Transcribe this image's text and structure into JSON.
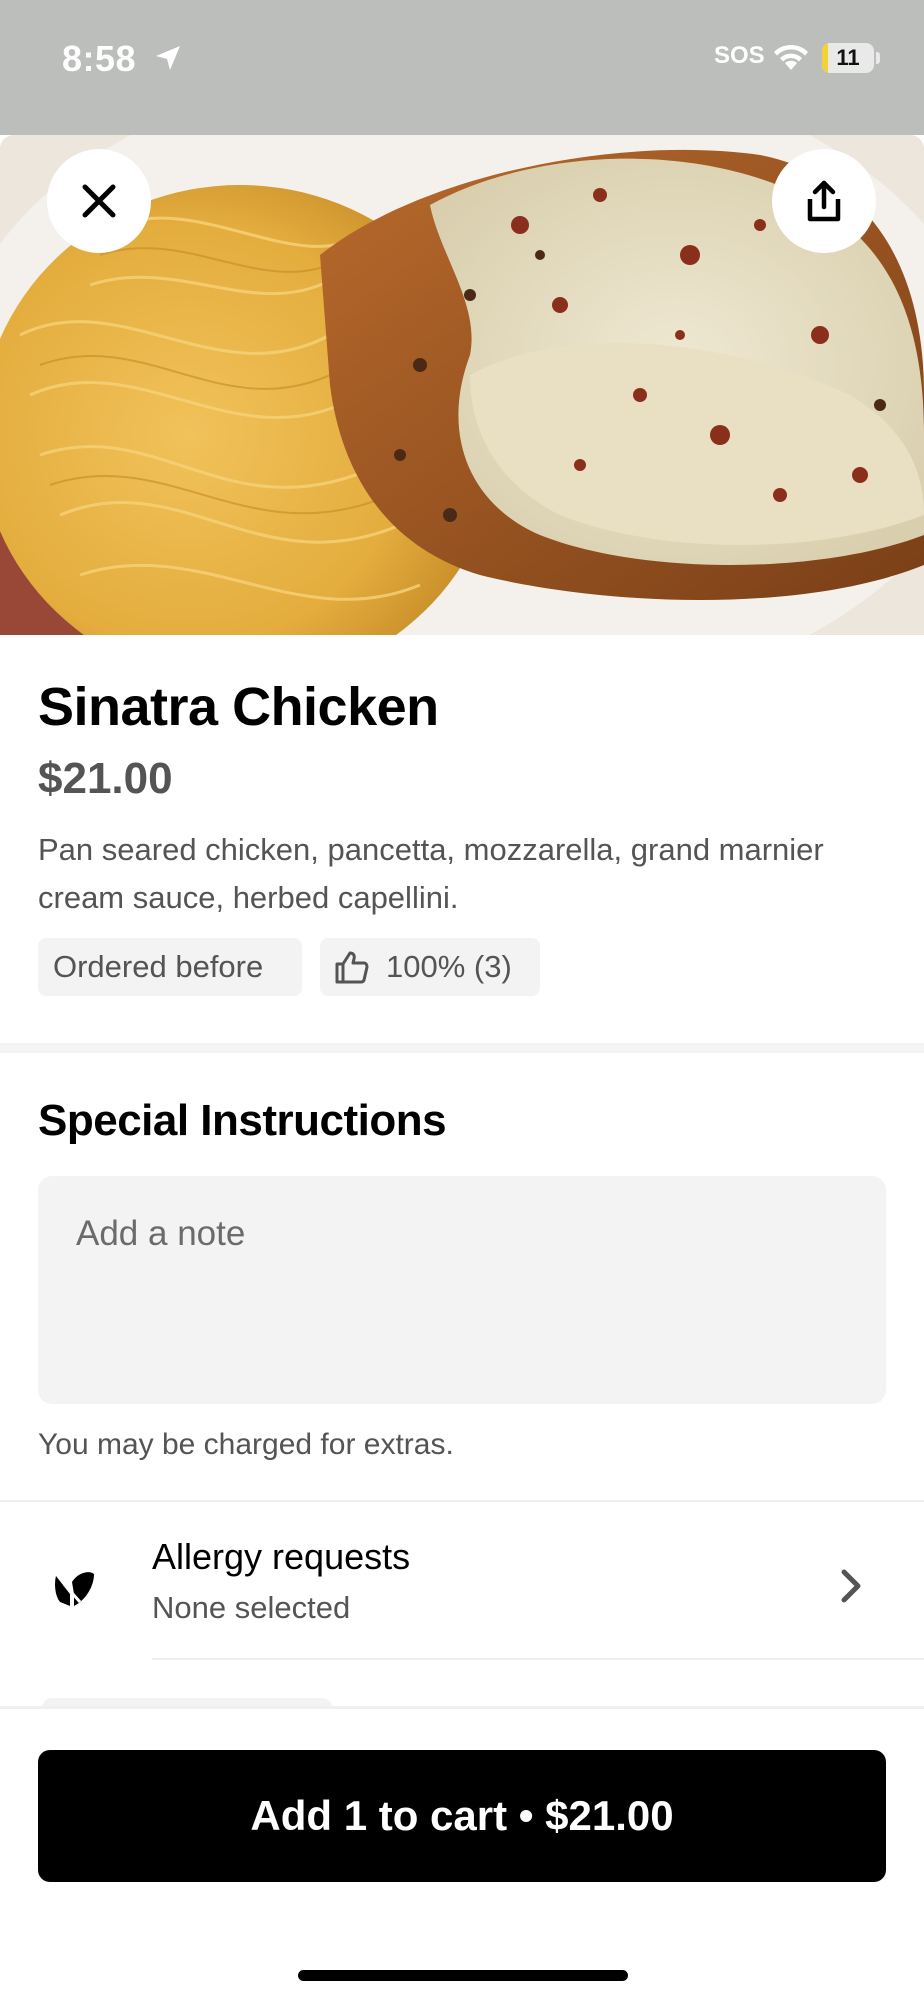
{
  "status_bar": {
    "time": "8:58",
    "carrier": "SOS",
    "battery_level": "11",
    "battery_fraction": 0.11,
    "battery_color": "#f3d238"
  },
  "hero": {
    "close_icon": "close-icon",
    "share_icon": "share-icon"
  },
  "item": {
    "title": "Sinatra Chicken",
    "price": "$21.00",
    "description": "Pan seared chicken, pancetta, mozzarella, grand marnier cream sauce, herbed capellini.",
    "tags": {
      "ordered_before": "Ordered before",
      "rating": "100% (3)",
      "rating_icon": "thumbs-up-icon"
    }
  },
  "special_instructions": {
    "title": "Special Instructions",
    "note_placeholder": "Add a note",
    "extras_note": "You may be charged for extras."
  },
  "allergy": {
    "title": "Allergy requests",
    "value": "None selected",
    "icon": "allergy-icon"
  },
  "cart": {
    "button_label": "Add 1 to cart • $21.00",
    "button_color": "#000000"
  }
}
